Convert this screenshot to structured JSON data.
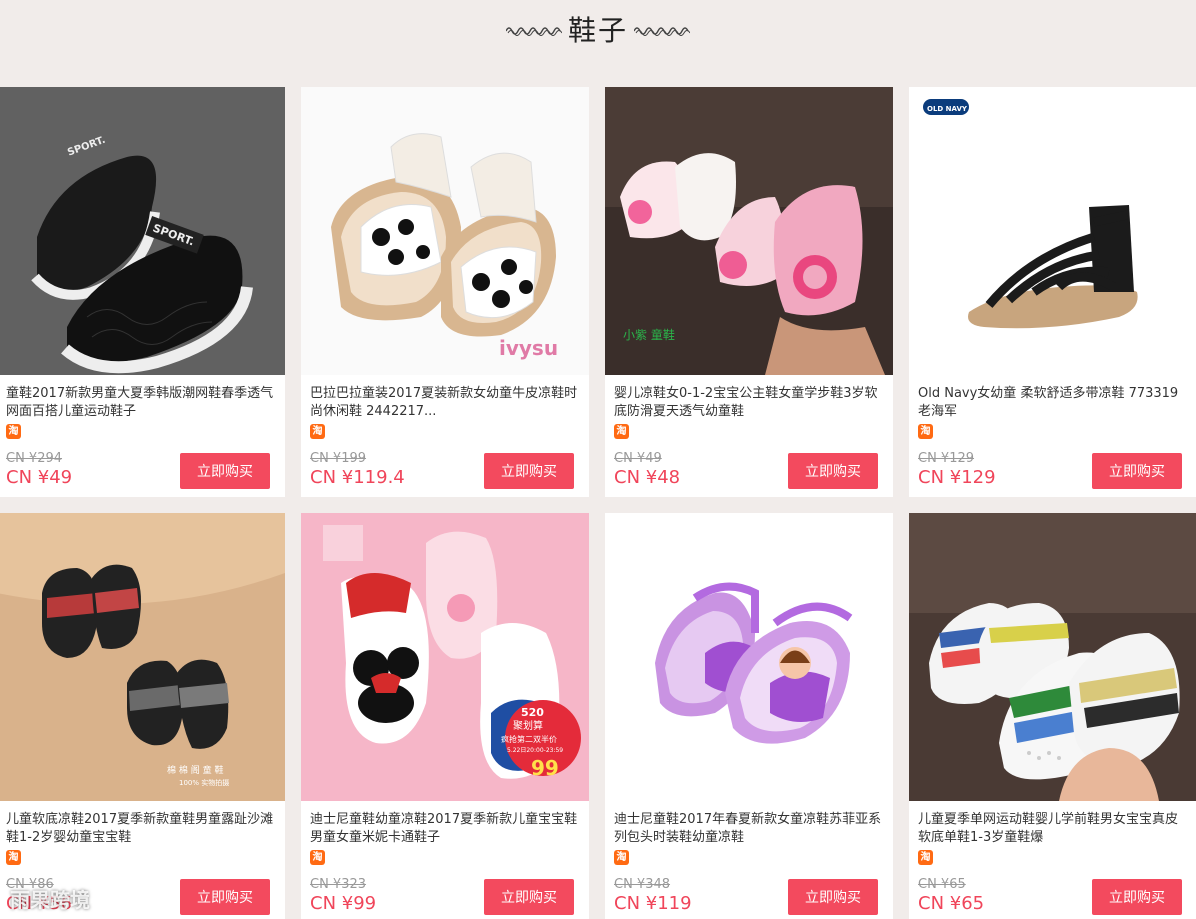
{
  "header": {
    "title": "鞋子"
  },
  "buy_label": "立即购买",
  "taobao_badge": "淘",
  "products": [
    {
      "title": "童鞋2017新款男童大夏季韩版潮网鞋春季透气网面百搭儿童运动鞋子",
      "old_price": "CN ¥294",
      "price": "CN ¥49"
    },
    {
      "title": "巴拉巴拉童装2017夏装新款女幼童牛皮凉鞋时尚休闲鞋 2442217...",
      "old_price": "CN ¥199",
      "price": "CN ¥119.4"
    },
    {
      "title": "婴儿凉鞋女0-1-2宝宝公主鞋女童学步鞋3岁软底防滑夏天透气幼童鞋",
      "old_price": "CN ¥49",
      "price": "CN ¥48"
    },
    {
      "title": "Old Navy女幼童 柔软舒适多带凉鞋 773319 老海军",
      "old_price": "CN ¥129",
      "price": "CN ¥129"
    },
    {
      "title": "儿童软底凉鞋2017夏季新款童鞋男童露趾沙滩鞋1-2岁婴幼童宝宝鞋",
      "old_price": "CN ¥86",
      "price": "CN ¥56"
    },
    {
      "title": "迪士尼童鞋幼童凉鞋2017夏季新款儿童宝宝鞋男童女童米妮卡通鞋子",
      "old_price": "CN ¥323",
      "price": "CN ¥99"
    },
    {
      "title": "迪士尼童鞋2017年春夏新款女童凉鞋苏菲亚系列包头时装鞋幼童凉鞋",
      "old_price": "CN ¥348",
      "price": "CN ¥119"
    },
    {
      "title": "儿童夏季单网运动鞋婴儿学前鞋男女宝宝真皮软底单鞋1-3岁童鞋爆",
      "old_price": "CN ¥65",
      "price": "CN ¥65"
    }
  ],
  "image_labels": {
    "ivysu": "ivysu",
    "old_navy": "OLD NAVY",
    "sport": "SPORT.",
    "sale_520": "520",
    "sale_text": "聚划算",
    "sale_sub": "疯抢第二双半价",
    "sale_price": "99",
    "sale_date": "5.22日20:00-23:59"
  },
  "watermark": "雨果跨境",
  "colors": {
    "accent": "#f34a5e",
    "price": "#f0455a",
    "background": "#f1ecea"
  }
}
